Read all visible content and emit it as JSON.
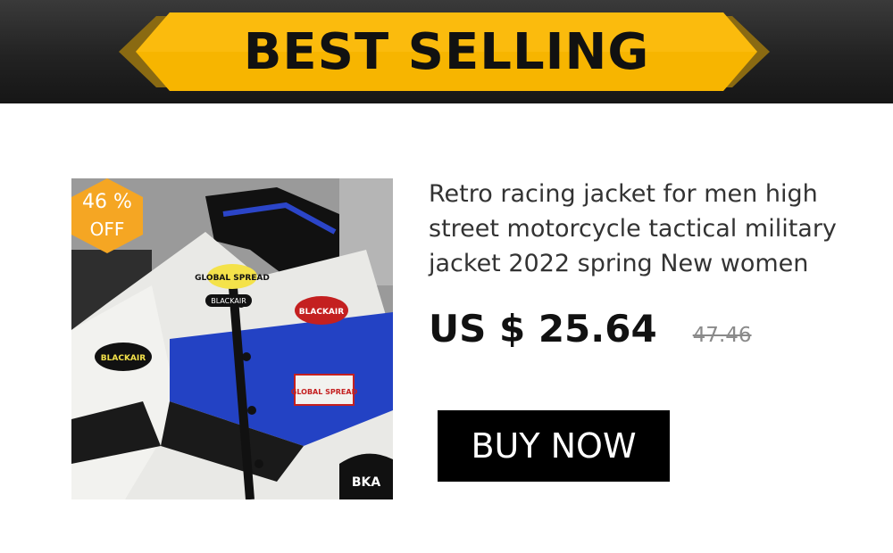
{
  "banner": {
    "title": "BEST SELLING",
    "colors": {
      "ribbon": "#f7b500",
      "ribbon_dark": "#b8860b",
      "background": "#222222"
    }
  },
  "product": {
    "image_name": "racing-jacket-photo",
    "image_patches": [
      "GLOBAL SPREAD",
      "BLACKAIR",
      "BLACKAIR",
      "BLACKAIR",
      "GLOBAL SPREAD",
      "BKA"
    ],
    "discount": {
      "percent": "46 %",
      "off": "OFF",
      "color": "#f5a623"
    },
    "title": "Retro racing jacket for men high street motorcycle tactical military jacket 2022 spring New women",
    "price": "US $ 25.64",
    "original_price": "47.46"
  },
  "buy_button": {
    "label": "BUY NOW"
  }
}
